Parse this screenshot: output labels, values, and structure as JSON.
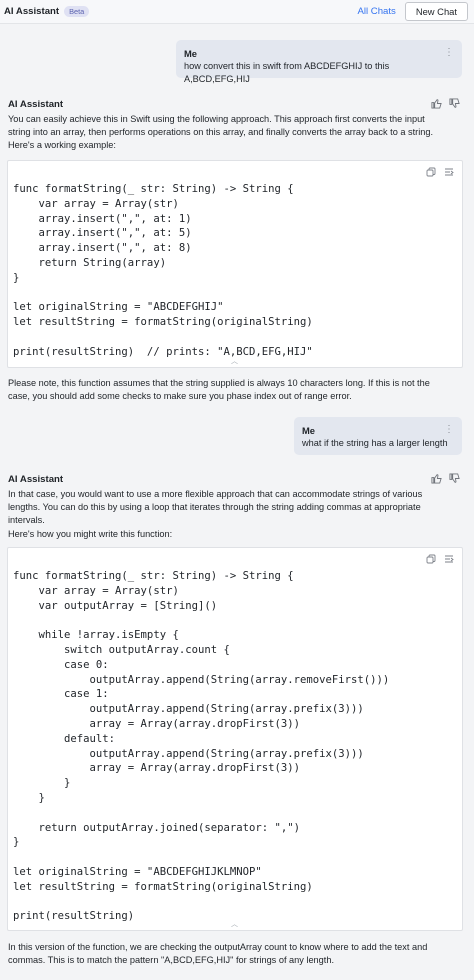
{
  "header": {
    "title": "AI Assistant",
    "badge": "Beta",
    "all_chats": "All Chats",
    "new_chat": "New Chat"
  },
  "messages": [
    {
      "author": "Me",
      "text": "how convert this in swift from ABCDEFGHIJ to this A,BCD,EFG,HIJ"
    },
    {
      "author": "AI Assistant",
      "intro": [
        "You can easily achieve this in Swift using the following approach. This approach first converts the input",
        "string into an array, then performs operations on this array, and finally converts the array back to a string.",
        "Here's a working example:"
      ],
      "code": "func formatString(_ str: String) -> String {\n    var array = Array(str)\n    array.insert(\",\", at: 1)\n    array.insert(\",\", at: 5)\n    array.insert(\",\", at: 8)\n    return String(array)\n}\n\nlet originalString = \"ABCDEFGHIJ\"\nlet resultString = formatString(originalString)\n\nprint(resultString)  // prints: \"A,BCD,EFG,HIJ\"",
      "outro": [
        "Please note, this function assumes that the string supplied is always 10 characters long. If this is not the",
        "case, you should add some checks to make sure you phase index out of range error."
      ]
    },
    {
      "author": "Me",
      "text": "what if the string has a larger length"
    },
    {
      "author": "AI Assistant",
      "intro": [
        "In that case, you would want to use a more flexible approach that can accommodate strings of various",
        "lengths. You can do this by using a loop that iterates through the string adding commas at appropriate",
        "intervals.",
        "Here's how you might write this function:"
      ],
      "code": "func formatString(_ str: String) -> String {\n    var array = Array(str)\n    var outputArray = [String]()\n\n    while !array.isEmpty {\n        switch outputArray.count {\n        case 0:\n            outputArray.append(String(array.removeFirst()))\n        case 1:\n            outputArray.append(String(array.prefix(3)))\n            array = Array(array.dropFirst(3))\n        default:\n            outputArray.append(String(array.prefix(3)))\n            array = Array(array.dropFirst(3))\n        }\n    }\n\n    return outputArray.joined(separator: \",\")\n}\n\nlet originalString = \"ABCDEFGHIJKLMNOP\"\nlet resultString = formatString(originalString)\n\nprint(resultString)",
      "outro": [
        "In this version of the function, we are checking the outputArray count to know where to add the text and",
        "commas. This is to match the pattern \"A,BCD,EFG,HIJ\" for strings of any length."
      ]
    }
  ],
  "icons": {
    "more": "more-vertical-icon",
    "thumbs_up": "thumbs-up-icon",
    "thumbs_down": "thumbs-down-icon",
    "copy": "copy-icon",
    "insert": "insert-snippet-icon"
  },
  "colors": {
    "accent": "#3574f0",
    "badge_bg": "#dfe1f3",
    "badge_text": "#5c63b0",
    "user_bubble": "#e3e7ef",
    "background": "#f3f4f6"
  }
}
